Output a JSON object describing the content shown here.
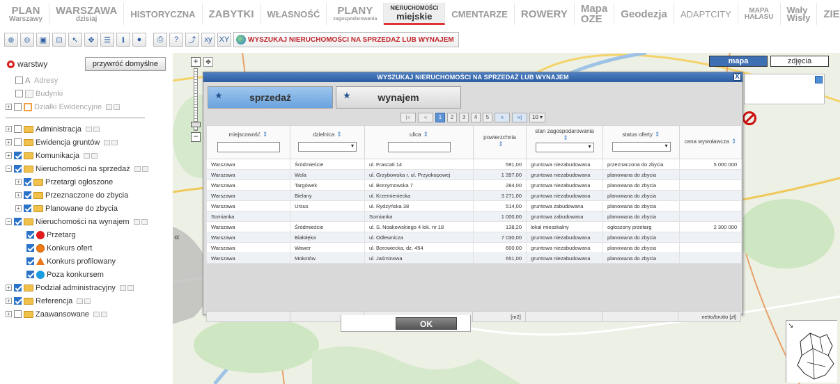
{
  "topnav": {
    "tabs": [
      {
        "line1": "PLAN",
        "line2": "Warszawy",
        "id": "plan-warszawy"
      },
      {
        "line1": "WARSZAWA",
        "line2": "dzisiaj",
        "id": "warszawa-dzisiaj"
      },
      {
        "line1": "HISTORYCZNA",
        "line2": "",
        "id": "historyczna"
      },
      {
        "line1": "ZABYTKI",
        "line2": "",
        "id": "zabytki"
      },
      {
        "line1": "WŁASNOŚĆ",
        "line2": "",
        "id": "wlasnosc"
      },
      {
        "line1": "PLANY",
        "line2": "zagospodarowania",
        "id": "plany"
      },
      {
        "line1": "NIERUCHOMOŚCI",
        "line2": "miejskie",
        "id": "nieruchomosci"
      },
      {
        "line1": "CMENTARZE",
        "line2": "",
        "id": "cmentarze"
      },
      {
        "line1": "ROWERY",
        "line2": "",
        "id": "rowery"
      },
      {
        "line1": "Mapa OZE",
        "line2": "",
        "id": "mapa-oze"
      },
      {
        "line1": "Geodezja",
        "line2": "",
        "id": "geodezja"
      },
      {
        "line1": "ADAPTCITY",
        "line2": "",
        "id": "adaptcity"
      },
      {
        "line1": "MAPA",
        "line2": "HAŁASU",
        "id": "mapa-halasu"
      },
      {
        "line1": "Wały Wisły",
        "line2": "",
        "id": "waly-wisly"
      },
      {
        "line1": "ZIELEŃ",
        "line2": "",
        "id": "zielen"
      }
    ]
  },
  "toolbar": {
    "search_label": "WYSZUKAJ NIERUCHOMOŚCI NA SPRZEDAŻ LUB WYNAJEM"
  },
  "left_panel": {
    "title": "warstwy",
    "restore_label": "przywróć domyślne",
    "layers": {
      "adresy": "Adresy",
      "budynki": "Budynki",
      "dzialki": "Działki Ewidencyjne",
      "administracja": "Administracja",
      "ewidencja": "Ewidencja gruntów",
      "komunikacja": "Komunikacja",
      "sprzedaz": "Nieruchomości na sprzedaż",
      "przetargi": "Przetargi ogłoszone",
      "przeznaczone": "Przeznaczone do zbycia",
      "planowane": "Planowane do zbycia",
      "wynajem": "Nieruchomości na wynajem",
      "przetarg": "Przetarg",
      "konkurs_ofert": "Konkurs ofert",
      "konkurs_prof": "Konkurs profilowany",
      "poza_konkursem": "Poza konkursem",
      "podzial": "Podział administracyjny",
      "referencja": "Referencja",
      "zaawansowane": "Zaawansowane"
    }
  },
  "map": {
    "type_map": "mapa",
    "type_photo": "zdjęcia"
  },
  "dialog": {
    "title": "WYSZUKAJ NIERUCHOMOŚCI NA SPRZEDAŻ LUB WYNAJEM",
    "close": "X",
    "tab_sale": "sprzedaż",
    "tab_rent": "wynajem",
    "pages": [
      "1",
      "2",
      "3",
      "4",
      "5"
    ],
    "per_page": "10",
    "columns": {
      "miejscowosc": "miejscowość",
      "dzielnica": "dzielnica",
      "ulica": "ulica",
      "powierzchnia": "powierzchnia",
      "stan": "stan zagospodarowania",
      "status": "status oferty",
      "cena": "cena wywoławcza"
    },
    "rows": [
      [
        "Warszawa",
        "Śródmieście",
        "ul. Frascati 14",
        "591,00",
        "gruntowa niezabudowana",
        "przeznaczona do zbycia",
        "5 000 000"
      ],
      [
        "Warszawa",
        "Wola",
        "ul. Grzybowska r. ul. Przyokopowej",
        "1 397,00",
        "gruntowa niezabudowana",
        "planowana do zbycia",
        ""
      ],
      [
        "Warszawa",
        "Targówek",
        "ul. Borzymowska 7",
        "284,00",
        "gruntowa niezabudowana",
        "planowana do zbycia",
        ""
      ],
      [
        "Warszawa",
        "Bielany",
        "ul. Krzemieniecka",
        "3 271,00",
        "gruntowa niezabudowana",
        "planowana do zbycia",
        ""
      ],
      [
        "Warszawa",
        "Ursus",
        "ul. Rydzyńska 38",
        "514,00",
        "gruntowa zabudowana",
        "planowana do zbycia",
        ""
      ],
      [
        "Somianka",
        "",
        "Somianka",
        "1 000,00",
        "gruntowa zabudowana",
        "planowana do zbycia",
        ""
      ],
      [
        "Warszawa",
        "Śródmieście",
        "ul. S. Noakowskiego 4 lok. nr 18",
        "138,20",
        "lokal mieszkalny",
        "ogłoszony przetarg",
        "2 300 000"
      ],
      [
        "Warszawa",
        "Białołęka",
        "ul. Odlewnicza",
        "7 030,00",
        "gruntowa niezabudowana",
        "planowana do zbycia",
        ""
      ],
      [
        "Warszawa",
        "Wawer",
        "ul. Borowiecka, dz. 454",
        "600,00",
        "gruntowa niezabudowana",
        "planowana do zbycia",
        ""
      ],
      [
        "Warszawa",
        "Mokotów",
        "ul. Jaśminowa",
        "651,00",
        "gruntowa niezabudowana",
        "planowana do zbycia",
        ""
      ]
    ],
    "footer_area": "[m2]",
    "footer_price": "netto/brutto [zł]",
    "ok": "OK"
  }
}
